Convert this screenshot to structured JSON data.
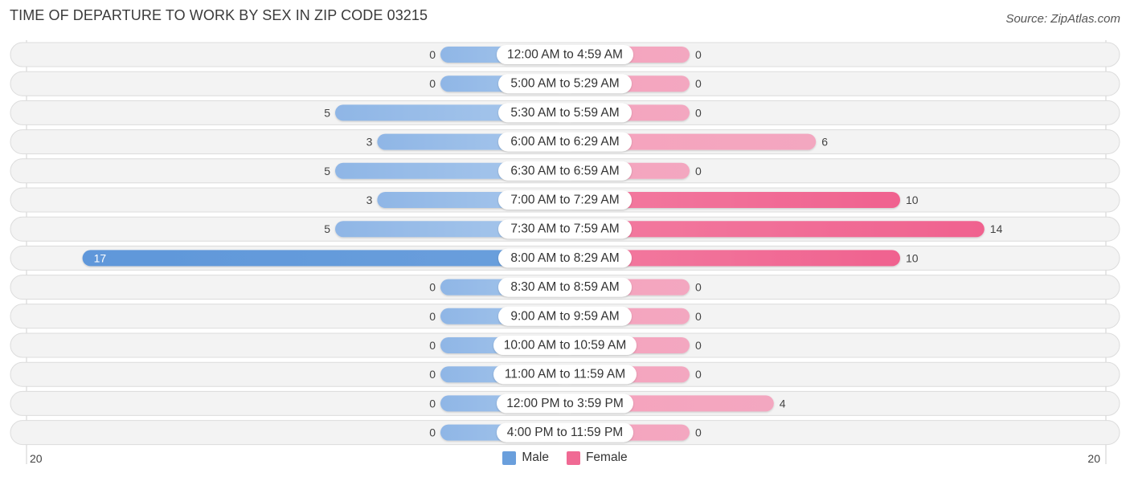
{
  "chart_data": {
    "type": "bar",
    "orientation": "horizontal-diverging",
    "title": "TIME OF DEPARTURE TO WORK BY SEX IN ZIP CODE 03215",
    "source": "Source: ZipAtlas.com",
    "categories": [
      "12:00 AM to 4:59 AM",
      "5:00 AM to 5:29 AM",
      "5:30 AM to 5:59 AM",
      "6:00 AM to 6:29 AM",
      "6:30 AM to 6:59 AM",
      "7:00 AM to 7:29 AM",
      "7:30 AM to 7:59 AM",
      "8:00 AM to 8:29 AM",
      "8:30 AM to 8:59 AM",
      "9:00 AM to 9:59 AM",
      "10:00 AM to 10:59 AM",
      "11:00 AM to 11:59 AM",
      "12:00 PM to 3:59 PM",
      "4:00 PM to 11:59 PM"
    ],
    "series": [
      {
        "name": "Male",
        "color": "#6a9fdc",
        "values": [
          0,
          0,
          5,
          3,
          5,
          3,
          5,
          17,
          0,
          0,
          0,
          0,
          0,
          0
        ]
      },
      {
        "name": "Female",
        "color": "#f06a94",
        "values": [
          0,
          0,
          0,
          6,
          0,
          10,
          14,
          10,
          0,
          0,
          0,
          0,
          4,
          0
        ]
      }
    ],
    "axis": {
      "left_label": "20",
      "right_label": "20",
      "max": 20
    },
    "legend": {
      "position": "bottom-center",
      "items": [
        "Male",
        "Female"
      ]
    },
    "xlabel": "",
    "ylabel": ""
  }
}
